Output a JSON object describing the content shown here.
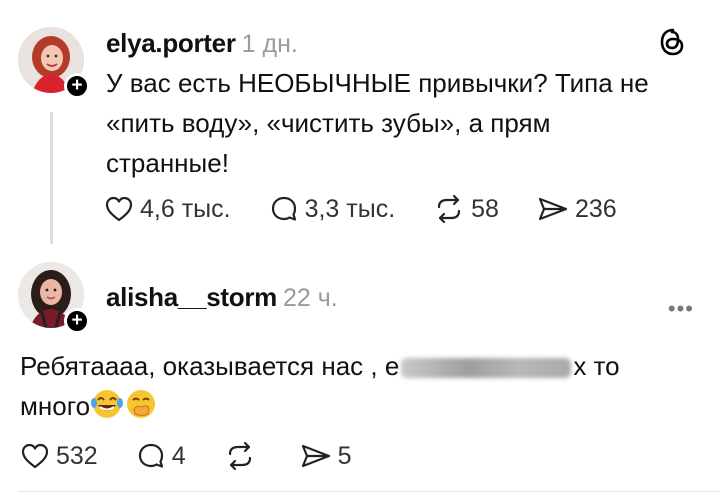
{
  "posts": [
    {
      "username": "elya.porter",
      "time": "1 дн.",
      "text_lines": [
        "У вас есть НЕОБЫЧНЫЕ привычки? Типа не",
        "«пить воду», «чистить зубы», а прям",
        "странные!"
      ],
      "likes": "4,6 тыс.",
      "replies": "3,3 тыс.",
      "reposts": "58",
      "shares": "236"
    },
    {
      "username": "alisha__storm",
      "time": "22 ч.",
      "text_line1_start": "Ребятаааа, оказывается нас , е",
      "text_line1_end": "х то",
      "text_line2": "много",
      "likes": "532",
      "replies": "4",
      "reposts": "",
      "shares": "5"
    }
  ],
  "icons": {
    "logo": "threads-logo-icon",
    "like": "heart-icon",
    "reply": "speech-bubble-icon",
    "repost": "repost-icon",
    "share": "paper-plane-icon",
    "more": "more-dots-icon",
    "follow": "plus-icon"
  },
  "colors": {
    "text": "#111111",
    "muted": "#9a9a9a",
    "thread_line": "#dcdcdc"
  }
}
